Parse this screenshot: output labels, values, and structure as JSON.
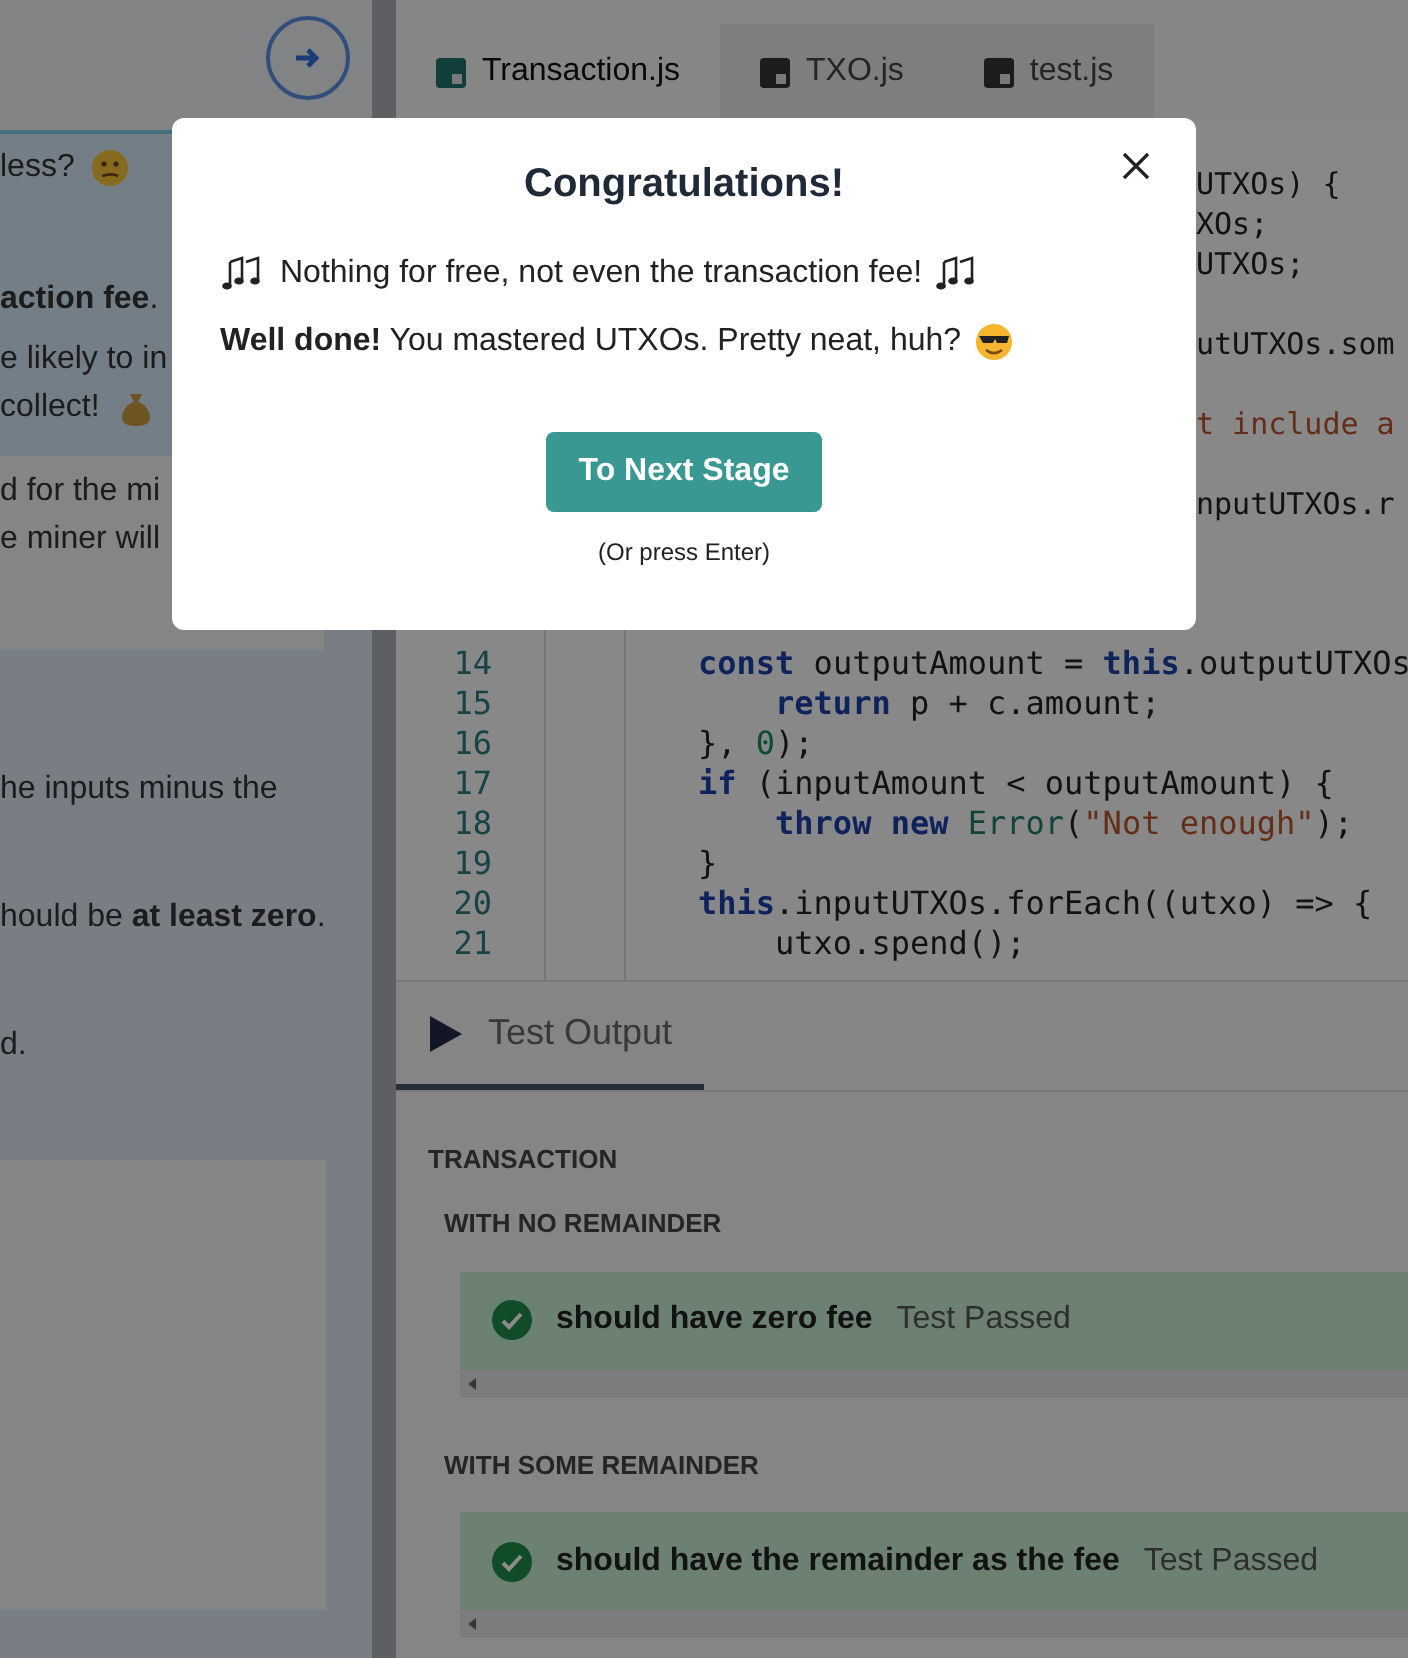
{
  "tabs": [
    {
      "label": "Transaction.js",
      "selected": true
    },
    {
      "label": "TXO.js",
      "selected": false
    },
    {
      "label": "test.js",
      "selected": false
    }
  ],
  "instructions": {
    "hint": [
      "less?",
      "**action fee**.",
      "e likely to in",
      "collect!"
    ],
    "note": [
      "d for the mi",
      "e miner will"
    ],
    "body": [
      "he inputs minus the",
      "hould be **at least zero**.",
      "d."
    ]
  },
  "code_fragments": [
    {
      "kind": "plain",
      "text": "UTXOs) {"
    },
    {
      "kind": "plain",
      "text": "XOs;"
    },
    {
      "kind": "plain",
      "text": "UTXOs;"
    },
    {
      "kind": "plain",
      "text": "utUTXOs.som"
    },
    {
      "kind": "string",
      "text": "t include a"
    },
    {
      "kind": "plain",
      "text": "nputUTXOs.r"
    }
  ],
  "code": [
    {
      "number": "14",
      "tokens": [
        {
          "kind": "keyword",
          "text": "const"
        },
        {
          "kind": "plain",
          "text": " outputAmount = "
        },
        {
          "kind": "keyword",
          "text": "this"
        },
        {
          "kind": "plain",
          "text": ".outputUTXOs"
        }
      ]
    },
    {
      "number": "15",
      "tokens": [
        {
          "kind": "keyword",
          "text": "    return"
        },
        {
          "kind": "plain",
          "text": " p + c.amount;"
        }
      ]
    },
    {
      "number": "16",
      "tokens": [
        {
          "kind": "plain",
          "text": "}, "
        },
        {
          "kind": "number",
          "text": "0"
        },
        {
          "kind": "plain",
          "text": ");"
        }
      ]
    },
    {
      "number": "17",
      "tokens": [
        {
          "kind": "keyword",
          "text": "if"
        },
        {
          "kind": "plain",
          "text": " (inputAmount < outputAmount) {"
        }
      ]
    },
    {
      "number": "18",
      "tokens": [
        {
          "kind": "keyword",
          "text": "    throw new"
        },
        {
          "kind": "type",
          "text": " Error"
        },
        {
          "kind": "plain",
          "text": "("
        },
        {
          "kind": "string",
          "text": "\"Not enough\""
        },
        {
          "kind": "plain",
          "text": ");"
        }
      ]
    },
    {
      "number": "19",
      "tokens": [
        {
          "kind": "plain",
          "text": "}"
        }
      ]
    },
    {
      "number": "20",
      "tokens": [
        {
          "kind": "keyword",
          "text": "this"
        },
        {
          "kind": "plain",
          "text": ".inputUTXOs.forEach((utxo) => {"
        }
      ]
    },
    {
      "number": "21",
      "tokens": [
        {
          "kind": "plain",
          "text": "    utxo.spend();"
        }
      ]
    }
  ],
  "test_output": {
    "title": "Test Output",
    "suite": "TRANSACTION",
    "groups": [
      {
        "title": "WITH NO REMAINDER",
        "tests": [
          {
            "name": "should have zero fee",
            "status": "Test Passed",
            "passed": true
          }
        ]
      },
      {
        "title": "WITH SOME REMAINDER",
        "tests": [
          {
            "name": "should have the remainder as the fee",
            "status": "Test Passed",
            "passed": true
          }
        ]
      }
    ]
  },
  "modal": {
    "title": "Congratulations!",
    "lines": [
      "Nothing for free, not even the transaction fee!",
      "**Well done!** You mastered UTXOs. Pretty neat, huh?"
    ],
    "button": "To Next Stage",
    "hint": "(Or press Enter)"
  }
}
